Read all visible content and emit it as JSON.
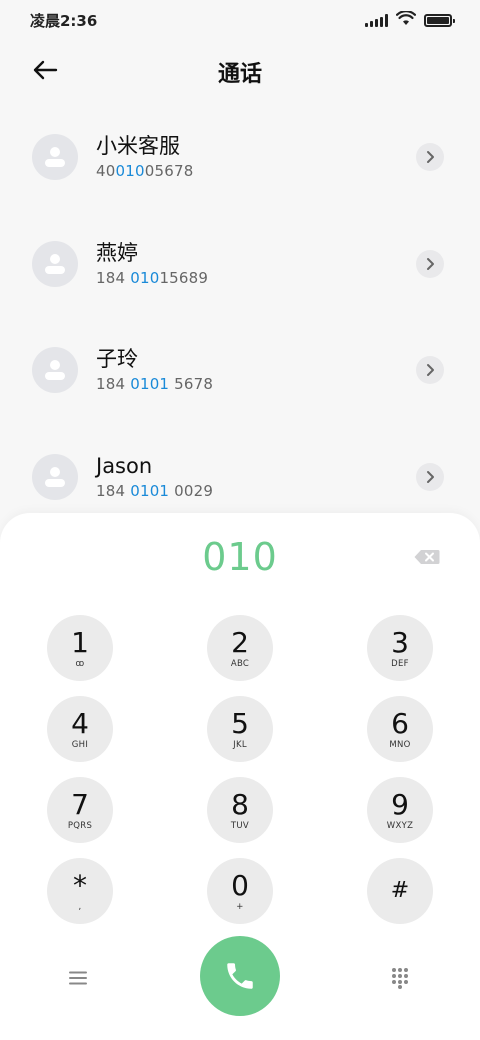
{
  "status_bar": {
    "time": "凌晨2:36",
    "icons": [
      "signal-icon",
      "wifi-icon",
      "battery-icon"
    ]
  },
  "header": {
    "title": "通话",
    "back_icon": "arrow-left-icon"
  },
  "contacts": [
    {
      "name": "小米客服",
      "number_parts": [
        "40",
        "010",
        "05678"
      ]
    },
    {
      "name": "燕婷",
      "number_parts": [
        "184 ",
        "010",
        "15689"
      ]
    },
    {
      "name": "子玲",
      "number_parts": [
        "184 ",
        "0101",
        " 5678"
      ]
    },
    {
      "name": "Jason",
      "number_parts": [
        "184 ",
        "0101",
        " 0029"
      ]
    }
  ],
  "dialer": {
    "input": "010",
    "keys": [
      {
        "digit": "1",
        "letters": "ꝏ"
      },
      {
        "digit": "2",
        "letters": "ABC"
      },
      {
        "digit": "3",
        "letters": "DEF"
      },
      {
        "digit": "4",
        "letters": "GHI"
      },
      {
        "digit": "5",
        "letters": "JKL"
      },
      {
        "digit": "6",
        "letters": "MNO"
      },
      {
        "digit": "7",
        "letters": "PQRS"
      },
      {
        "digit": "8",
        "letters": "TUV"
      },
      {
        "digit": "9",
        "letters": "WXYZ"
      },
      {
        "digit": "*",
        "letters": ","
      },
      {
        "digit": "0",
        "letters": "+"
      },
      {
        "digit": "#",
        "letters": ""
      }
    ]
  },
  "colors": {
    "accent_green": "#6ccb8d",
    "highlight_blue": "#1a8ad8",
    "background": "#f7f7f7",
    "key_background": "#ebebeb"
  }
}
